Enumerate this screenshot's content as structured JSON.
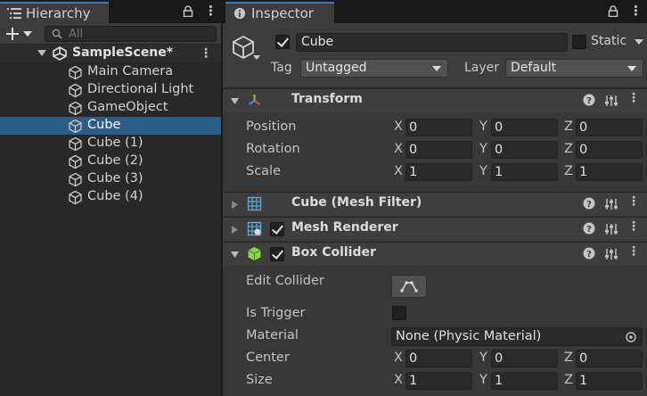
{
  "hierarchy": {
    "tab_title": "Hierarchy",
    "search_placeholder": "All",
    "scene_name": "SampleScene*",
    "items": [
      {
        "label": "Main Camera",
        "selected": false
      },
      {
        "label": "Directional Light",
        "selected": false
      },
      {
        "label": "GameObject",
        "selected": false
      },
      {
        "label": "Cube",
        "selected": true
      },
      {
        "label": "Cube (1)",
        "selected": false
      },
      {
        "label": "Cube (2)",
        "selected": false
      },
      {
        "label": "Cube (3)",
        "selected": false
      },
      {
        "label": "Cube (4)",
        "selected": false
      }
    ]
  },
  "inspector": {
    "tab_title": "Inspector",
    "object_name": "Cube",
    "active": true,
    "static_label": "Static",
    "static": false,
    "tag_label": "Tag",
    "tag_value": "Untagged",
    "layer_label": "Layer",
    "layer_value": "Default",
    "transform": {
      "title": "Transform",
      "position_label": "Position",
      "rotation_label": "Rotation",
      "scale_label": "Scale",
      "axes": [
        "X",
        "Y",
        "Z"
      ],
      "position": [
        "0",
        "0",
        "0"
      ],
      "rotation": [
        "0",
        "0",
        "0"
      ],
      "scale": [
        "1",
        "1",
        "1"
      ]
    },
    "mesh_filter": {
      "title": "Cube (Mesh Filter)"
    },
    "mesh_renderer": {
      "title": "Mesh Renderer",
      "enabled": true
    },
    "box_collider": {
      "title": "Box Collider",
      "enabled": true,
      "edit_collider_label": "Edit Collider",
      "is_trigger_label": "Is Trigger",
      "is_trigger": false,
      "material_label": "Material",
      "material_value": "None (Physic Material)",
      "center_label": "Center",
      "size_label": "Size",
      "center": [
        "0",
        "0",
        "0"
      ],
      "size": [
        "1",
        "1",
        "1"
      ]
    }
  },
  "colors": {
    "selection": "#2c5d87",
    "tab_accent": "#3a79bb",
    "panel_bg": "#383838",
    "field_bg": "#2a2a2a"
  }
}
